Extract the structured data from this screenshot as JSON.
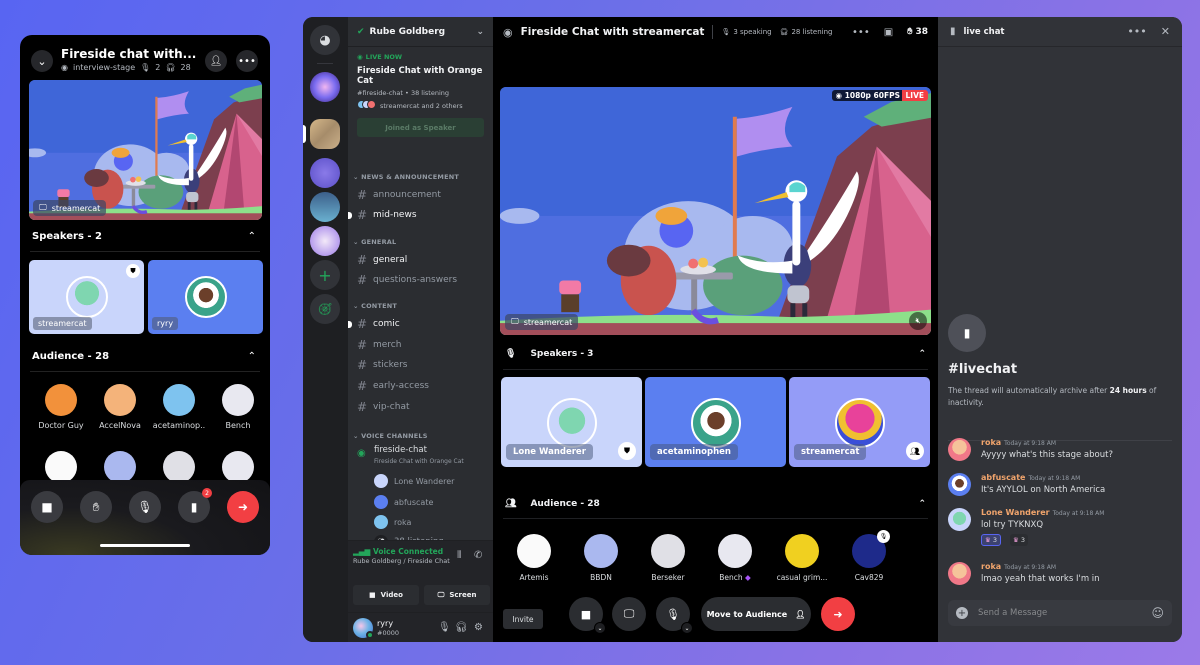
{
  "colors": {
    "accent": "#5865f2",
    "live": "#f23f43",
    "online": "#23a55a",
    "username": "#f0a46c"
  },
  "mobile": {
    "title": "Fireside chat with...",
    "stage_name": "interview-stage",
    "speaking_count": "2",
    "listening_count": "28",
    "stream_owner": "streamercat",
    "speakers_header": "Speakers - 2",
    "speakers": [
      {
        "name": "streamercat",
        "badge": "moderator-shield-icon"
      },
      {
        "name": "ryry"
      }
    ],
    "audience_header": "Audience - 28",
    "audience": [
      {
        "name": "Doctor Guy"
      },
      {
        "name": "AccelNova"
      },
      {
        "name": "acetaminop.."
      },
      {
        "name": "Bench"
      },
      {
        "name": ""
      },
      {
        "name": ""
      },
      {
        "name": ""
      },
      {
        "name": ""
      }
    ],
    "chat_badge": "2"
  },
  "server": {
    "name": "Rube Goldberg",
    "live_now_label": "LIVE NOW",
    "live_title": "Fireside Chat with Orange Cat",
    "live_channel": "#fireside-chat",
    "live_listening": "38 listening",
    "live_people": "streamercat and 2 others",
    "joined_button": "Joined as Speaker",
    "categories": [
      {
        "name": "NEWS & ANNOUNCEMENT",
        "channels": [
          {
            "name": "announcement",
            "unread": false
          },
          {
            "name": "mid-news",
            "unread": true
          }
        ]
      },
      {
        "name": "GENERAL",
        "channels": [
          {
            "name": "general",
            "unread": false,
            "bright": true
          },
          {
            "name": "questions-answers",
            "unread": false
          }
        ]
      },
      {
        "name": "CONTENT",
        "channels": [
          {
            "name": "comic",
            "unread": true
          },
          {
            "name": "merch",
            "unread": false
          },
          {
            "name": "stickers",
            "unread": false
          },
          {
            "name": "early-access",
            "unread": false
          },
          {
            "name": "vip-chat",
            "unread": false
          }
        ]
      }
    ],
    "voice_category": "VOICE CHANNELS",
    "voice_channel": {
      "name": "fireside-chat",
      "topic": "Fireside Chat with Orange Cat",
      "users": [
        "Lone Wanderer",
        "abfuscate",
        "roka"
      ],
      "listening": "38 listening"
    },
    "voice_status": "Voice Connected",
    "voice_location": "Rube Goldberg / Fireside Chat",
    "video_button": "Video",
    "screen_button": "Screen",
    "user": {
      "name": "ryry",
      "tag": "#0000"
    }
  },
  "stage": {
    "title": "Fireside Chat with streamercat",
    "speaking": "3 speaking",
    "listening": "28 listening",
    "hand_count": "38",
    "quality": "1080p 60FPS",
    "live_badge": "LIVE",
    "stream_owner": "streamercat",
    "speakers_header": "Speakers - 3",
    "speakers": [
      {
        "name": "Lone Wanderer",
        "icon": "moderator-shield-icon"
      },
      {
        "name": "acetaminophen"
      },
      {
        "name": "streamercat",
        "icon": "move-to-audience-icon"
      }
    ],
    "audience_header": "Audience - 28",
    "audience": [
      {
        "name": "Artemis"
      },
      {
        "name": "BBDN"
      },
      {
        "name": "Berseker"
      },
      {
        "name": "Bench"
      },
      {
        "name": "casual grim..."
      },
      {
        "name": "Cav829"
      }
    ],
    "invite_button": "Invite",
    "move_to_audience_button": "Move to Audience"
  },
  "chat": {
    "header": "live chat",
    "intro_title": "#livechat",
    "intro_desc_pre": "The thread will automatically archive after ",
    "intro_desc_bold": "24 hours",
    "intro_desc_post": " of inactivity.",
    "messages": [
      {
        "author": "roka",
        "time": "Today at 9:18 AM",
        "text": "Ayyyy what's this stage about?"
      },
      {
        "author": "abfuscate",
        "time": "Today at 9:18 AM",
        "text": "It's AYYLOL on North America"
      },
      {
        "author": "Lone Wanderer",
        "time": "Today at 9:18 AM",
        "text": "lol try TYKNXQ",
        "reactions": [
          {
            "count": "3",
            "mine": true
          },
          {
            "count": "3",
            "mine": false
          }
        ]
      },
      {
        "author": "roka",
        "time": "Today at 9:18 AM",
        "text": "lmao yeah that works I'm in"
      }
    ],
    "composer_placeholder": "Send a Message"
  }
}
